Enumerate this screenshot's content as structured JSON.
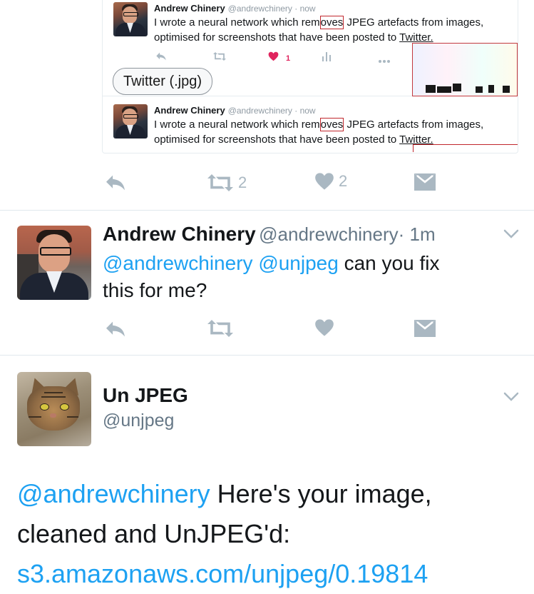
{
  "embedded_screenshot": {
    "tweet_1": {
      "name": "Andrew Chinery",
      "handle_time": "@andrewchinery · now",
      "text_before": "I wrote a neural network which rem",
      "text_marked": "oves",
      "text_after": " JPEG artefacts from images,",
      "text_line2_before": "optimised for screenshots that have been posted to ",
      "text_line2_link": "Twitter.",
      "like_count": "1"
    },
    "pill_label": "Twitter (.jpg)",
    "tweet_2": {
      "name": "Andrew Chinery",
      "handle_time": "@andrewchinery · now",
      "text_before": "I wrote a neural network which rem",
      "text_marked": "oves",
      "text_after": " JPEG artefacts from images,",
      "text_line2_before": "optimised for screenshots that have been posted to ",
      "text_line2_link": "Twitter."
    }
  },
  "top_actions": {
    "retweet_count": "2",
    "like_count": "2"
  },
  "main_tweet": {
    "name": "Andrew Chinery",
    "handle": "@andrewchinery",
    "time": "· 1m",
    "mention_1": "@andrewchinery",
    "mention_2": "@unjpeg",
    "text_rest": " can you fix",
    "text_line2": "this for me?"
  },
  "reply": {
    "name": "Un JPEG",
    "handle": "@unjpeg",
    "mention": "@andrewchinery",
    "text_1": " Here's your image,",
    "text_2": "cleaned and UnJPEG'd:",
    "link": "s3.amazonaws.com/unjpeg/0.19814"
  },
  "colors": {
    "accent": "#1da1f2",
    "icon_gray": "#aab8c2",
    "like_red": "#e0245e",
    "mark_red": "#c0272d"
  },
  "icons": [
    "reply-icon",
    "retweet-icon",
    "heart-icon",
    "dm-envelope-icon",
    "chevron-down-icon",
    "analytics-icon",
    "more-icon"
  ]
}
